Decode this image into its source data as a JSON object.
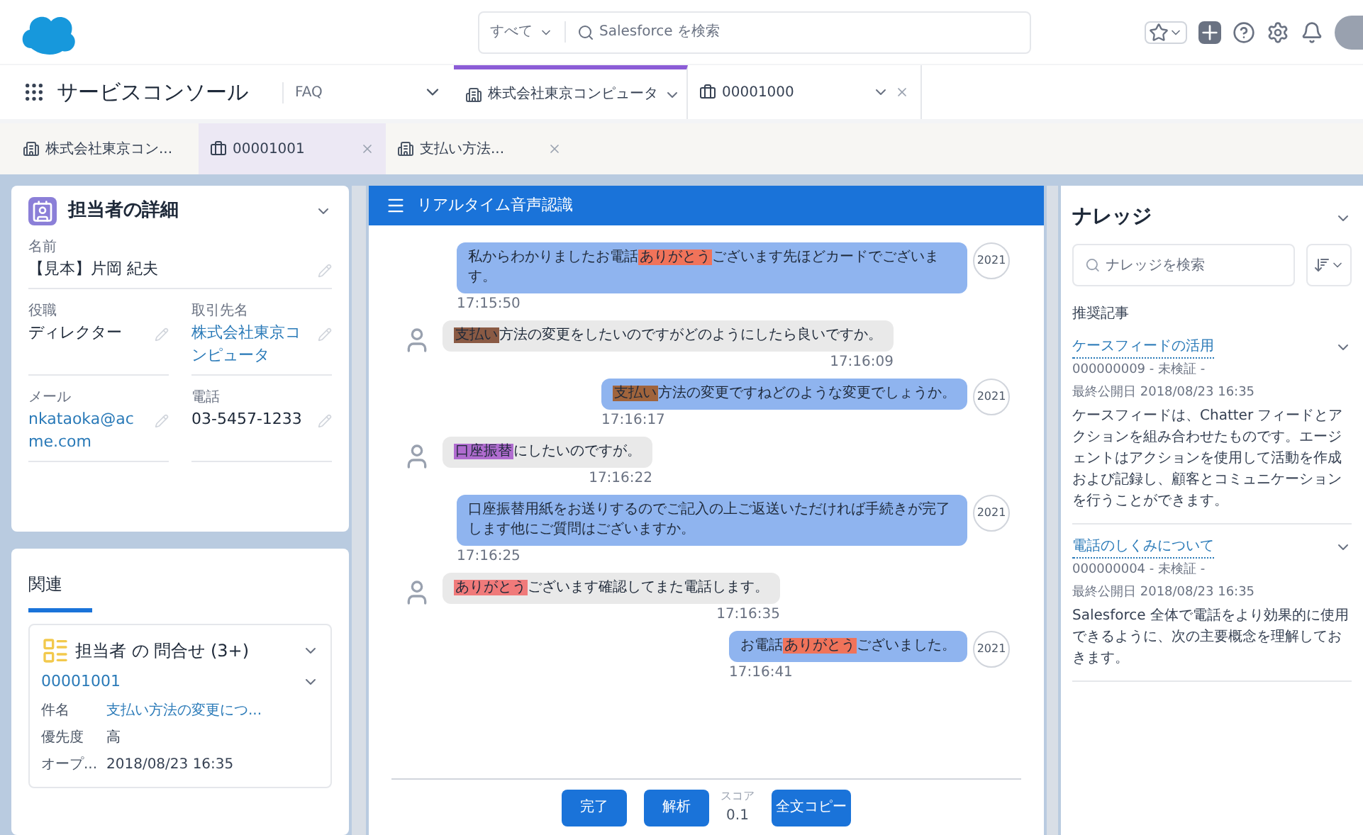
{
  "header": {
    "scope": "すべて",
    "search_placeholder": "Salesforce を検索"
  },
  "nav": {
    "app_name": "サービスコンソール",
    "items": [
      {
        "label": "FAQ"
      }
    ],
    "tabs": [
      {
        "label": "株式会社東京コンピュータ",
        "kind": "account",
        "selected": true
      },
      {
        "label": "00001000",
        "kind": "case",
        "selected": false
      }
    ]
  },
  "subtabs": [
    {
      "label": "株式会社東京コン...",
      "kind": "account",
      "selected": false,
      "closable": false
    },
    {
      "label": "00001001",
      "kind": "case",
      "selected": true,
      "closable": true
    },
    {
      "label": "支払い方法...",
      "kind": "account",
      "selected": false,
      "closable": true
    }
  ],
  "contact": {
    "title": "担当者の詳細",
    "fields": [
      {
        "label": "名前",
        "value": "【見本】片岡 紀夫",
        "link": false
      },
      {
        "label": "役職",
        "value": "ディレクター",
        "link": false
      },
      {
        "label": "取引先名",
        "value": "株式会社東京コンピュータ",
        "link": true
      },
      {
        "label": "メール",
        "value": "nkataoka@acme.com",
        "link": true
      },
      {
        "label": "電話",
        "value": "03-5457-1233",
        "link": false
      }
    ]
  },
  "related": {
    "tab": "関連",
    "list_title": "担当者 の 問合せ (3+)",
    "record": {
      "number": "00001001",
      "fields": [
        {
          "label": "件名",
          "value": "支払い方法の変更につ...",
          "link": true
        },
        {
          "label": "優先度",
          "value": "高",
          "link": false
        },
        {
          "label": "オープ...",
          "value": "2018/08/23 16:35",
          "link": false
        }
      ]
    }
  },
  "transcript": {
    "title": "リアルタイム音声認識",
    "messages": [
      {
        "kind": "agent",
        "badge": "2021",
        "time": "17:15:50",
        "parts": [
          {
            "text": "私からわかりましたお電話"
          },
          {
            "text": "ありがとう",
            "color": "#f0735a"
          },
          {
            "text": "ございます先ほどカードでございます。"
          }
        ]
      },
      {
        "kind": "customer",
        "time": "17:16:09",
        "parts": [
          {
            "text": "支払い",
            "color": "#8a5a44"
          },
          {
            "text": "方法の変更をしたいのですがどのようにしたら良いですか。"
          }
        ]
      },
      {
        "kind": "agent",
        "badge": "2021",
        "time": "17:16:17",
        "parts": [
          {
            "text": "支払い",
            "color": "#a0643c"
          },
          {
            "text": "方法の変更ですねどのような変更でしょうか。"
          }
        ]
      },
      {
        "kind": "customer",
        "time": "17:16:22",
        "parts": [
          {
            "text": "口座振替",
            "color": "#b06ccf"
          },
          {
            "text": "にしたいのですが。"
          }
        ]
      },
      {
        "kind": "agent",
        "badge": "2021",
        "time": "17:16:25",
        "parts": [
          {
            "text": "口座振替用紙をお送りするのでご記入の上ご返送いただければ手続きが完了します他にご質問はございますか。"
          }
        ]
      },
      {
        "kind": "customer",
        "time": "17:16:35",
        "parts": [
          {
            "text": "ありがとう",
            "color": "#f07a7a"
          },
          {
            "text": "ございます確認してまた電話します。"
          }
        ]
      },
      {
        "kind": "agent",
        "badge": "2021",
        "time": "17:16:41",
        "parts": [
          {
            "text": "お電話"
          },
          {
            "text": "ありがとう",
            "color": "#f0735a"
          },
          {
            "text": "ございました。"
          }
        ]
      }
    ],
    "buttons": [
      "完了",
      "解析"
    ],
    "score_label": "スコア",
    "score": "0.1",
    "copy_button": "全文コピー"
  },
  "knowledge": {
    "title": "ナレッジ",
    "search_placeholder": "ナレッジを検索",
    "section": "推奨記事",
    "articles": [
      {
        "title": "ケースフィードの活用",
        "meta": "000000009 - 未検証 -",
        "date": "最終公開日 2018/08/23 16:35",
        "body": "ケースフィードは、Chatter フィードとアクションを組み合わせたものです。エージェントはアクションを使用して活動を作成および記録し、顧客とコミュニケーションを行うことができます。"
      },
      {
        "title": "電話のしくみについて",
        "meta": "000000004 - 未検証 -",
        "date": "最終公開日 2018/08/23 16:35",
        "body": "Salesforce 全体で電話をより効果的に使用できるように、次の主要概念を理解しておきます。"
      }
    ]
  }
}
